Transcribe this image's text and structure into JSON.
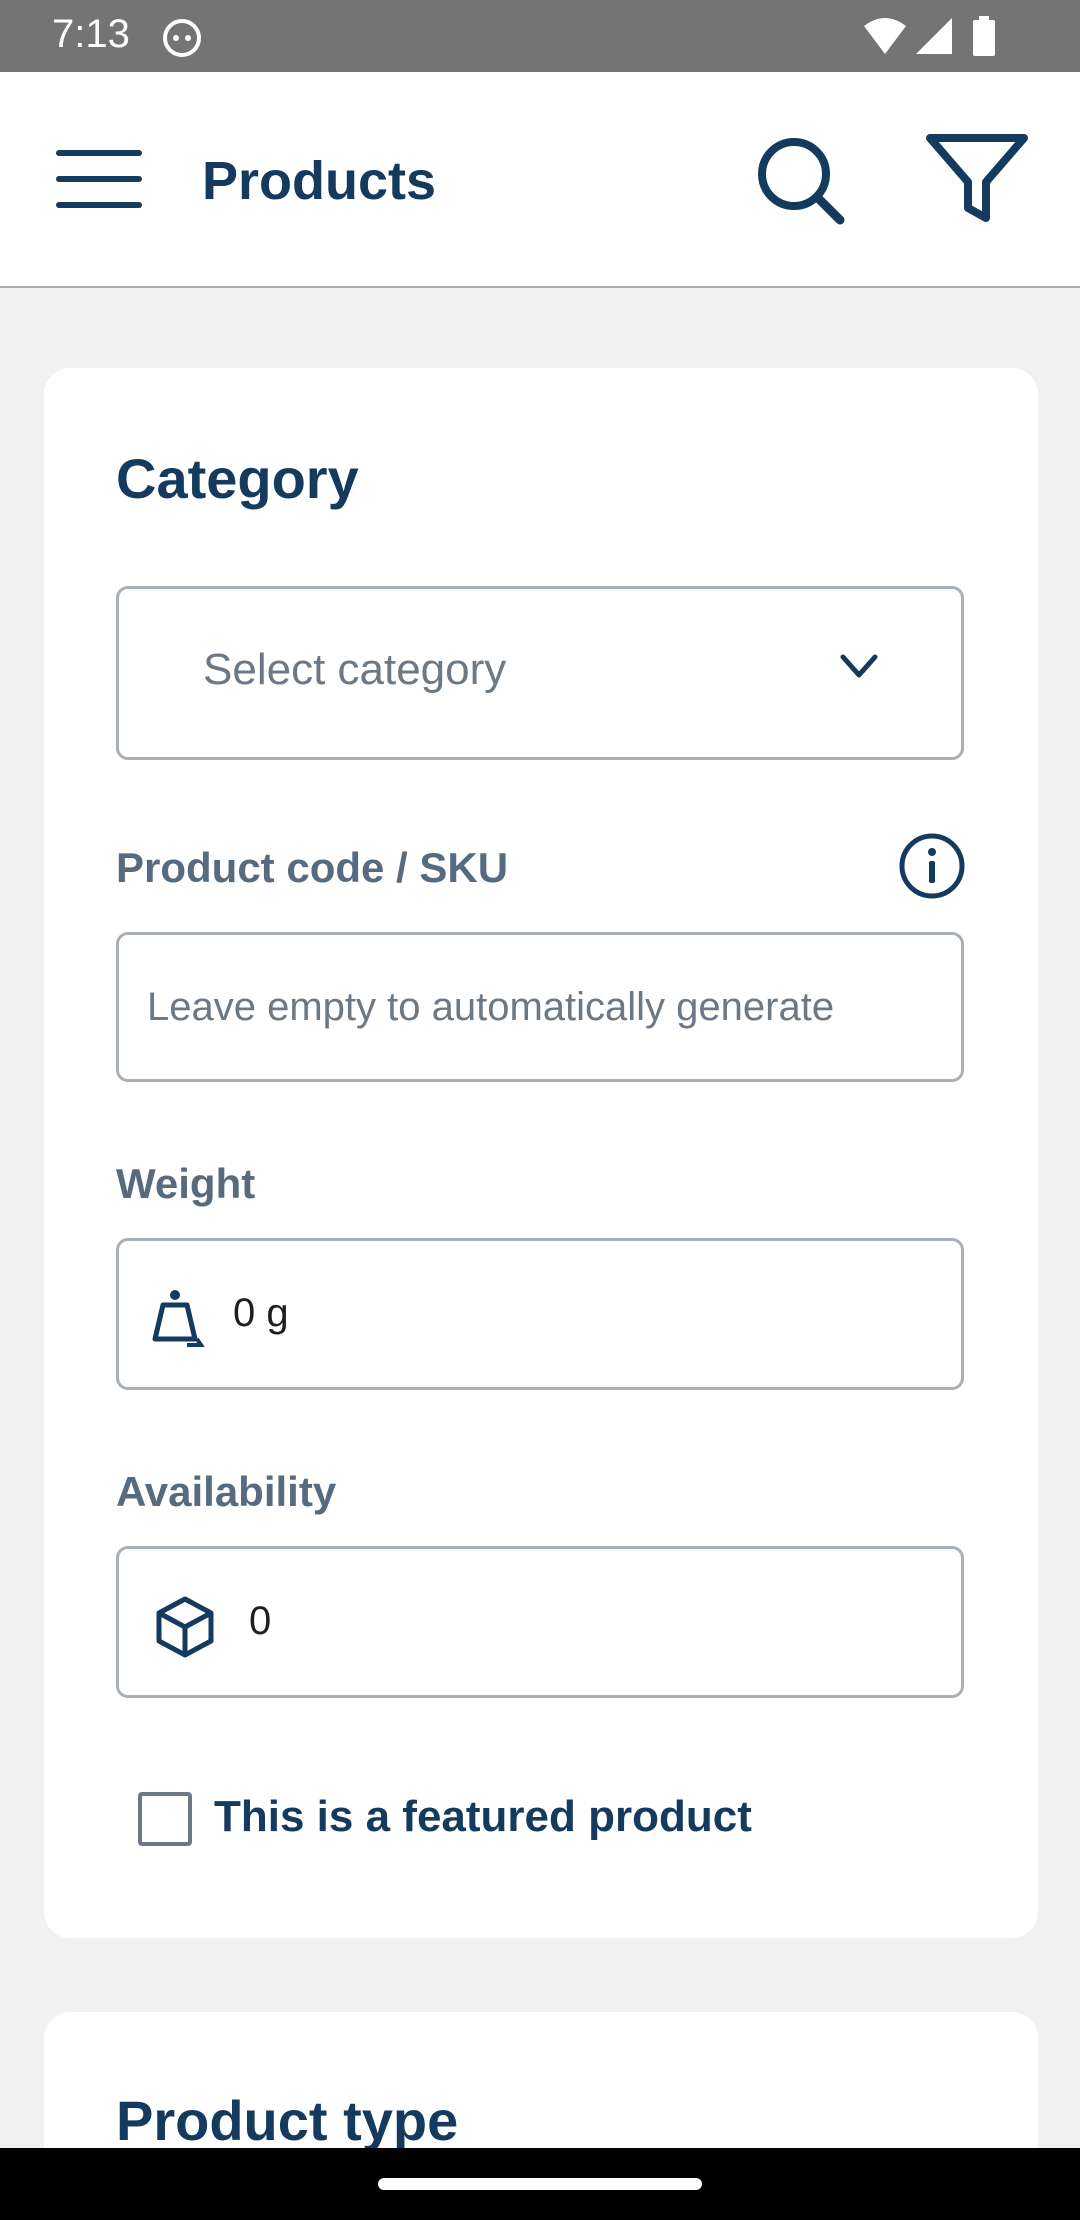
{
  "status_bar": {
    "time": "7:13",
    "icons": [
      "app-notification-icon",
      "wifi-icon",
      "signal-icon",
      "battery-icon"
    ]
  },
  "app_bar": {
    "title": "Products",
    "icons": [
      "menu-icon",
      "search-icon",
      "filter-icon"
    ]
  },
  "form": {
    "category_title": "Category",
    "category_select_value": "Select category",
    "sku_label": "Product code / SKU",
    "sku_placeholder": "Leave empty to automatically generate",
    "weight_label": "Weight",
    "weight_value": "0 g",
    "availability_label": "Availability",
    "availability_value": "0",
    "featured_label": "This is a featured product",
    "featured_checked": false
  },
  "next_section": {
    "title": "Product type"
  },
  "colors": {
    "primary": "#143a5e",
    "label": "#566b80",
    "border": "#a8afb6",
    "background": "#f1f1f1",
    "card": "#ffffff"
  }
}
